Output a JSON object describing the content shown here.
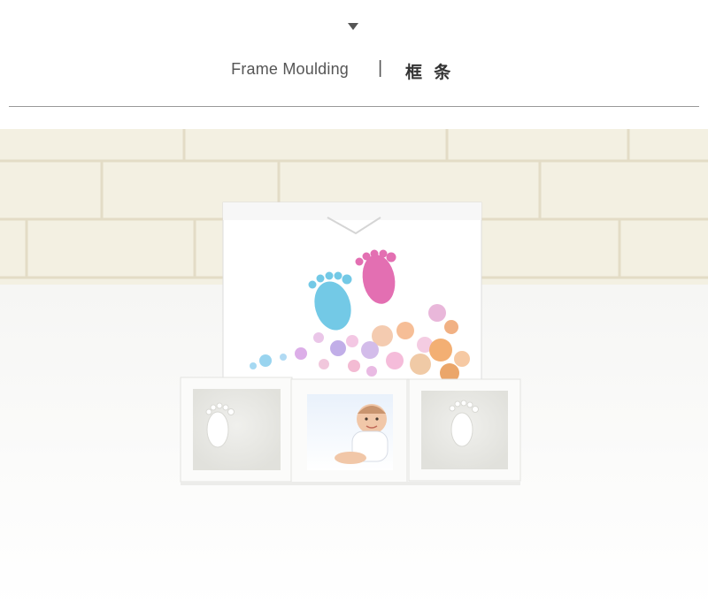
{
  "header": {
    "title_en": "Frame Moulding",
    "separator": "|",
    "title_cn": "框 条"
  },
  "photo": {
    "icons": {
      "indicator": "chevron-down-icon"
    },
    "colors": {
      "wall": "#f3f0e3",
      "floor": "#f7f7f7",
      "foot_blue": "#6fc7e4",
      "foot_pink": "#e46fb0"
    }
  }
}
